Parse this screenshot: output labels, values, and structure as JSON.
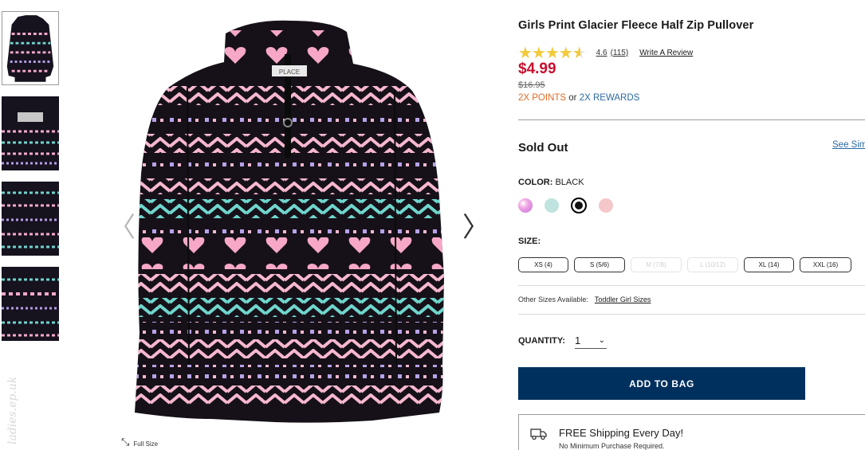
{
  "product": {
    "title": "Girls Print Glacier Fleece Half Zip Pullover",
    "rating_value": "4.6",
    "rating_fraction": 0.92,
    "review_count": "(115)",
    "write_review": "Write A Review",
    "price": "$4.99",
    "original_price": "$16.95",
    "points_label": "2X POINTS",
    "points_or": " or ",
    "rewards_label": "2X REWARDS"
  },
  "availability": {
    "status": "Sold Out",
    "see_similar": "See Sim"
  },
  "color": {
    "label": "COLOR:",
    "selected": "BLACK",
    "swatches": [
      {
        "name": "pink-multi",
        "color": "#e98fd8"
      },
      {
        "name": "mint",
        "color": "#bfe3df"
      },
      {
        "name": "black",
        "color": "#111111",
        "selected": true
      },
      {
        "name": "pink",
        "color": "#f5c7c9"
      }
    ]
  },
  "size": {
    "label": "SIZE:",
    "options": [
      {
        "label": "XS (4)",
        "available": true
      },
      {
        "label": "S (5/6)",
        "available": true
      },
      {
        "label": "M (7/8)",
        "available": false
      },
      {
        "label": "L (10/12)",
        "available": false
      },
      {
        "label": "XL (14)",
        "available": true
      },
      {
        "label": "XXL (16)",
        "available": true
      }
    ]
  },
  "other_sizes": {
    "label": "Other Sizes Available:",
    "link": "Toddler Girl Sizes"
  },
  "quantity": {
    "label": "QUANTITY:",
    "value": "1"
  },
  "cta": {
    "add_to_bag": "ADD TO BAG"
  },
  "shipping": {
    "title": "FREE Shipping Every Day!",
    "subtitle": "No Minimum Purchase Required."
  },
  "gallery": {
    "full_size": "Full Size",
    "brand_tag": "PLACE",
    "watermark": "ladies.ep.uk"
  },
  "colors": {
    "price_red": "#c8102e",
    "cta_navy": "#00305e",
    "link_blue": "#2b6aa3",
    "points_orange": "#e06b25",
    "star_gold": "#f2cb3b"
  }
}
